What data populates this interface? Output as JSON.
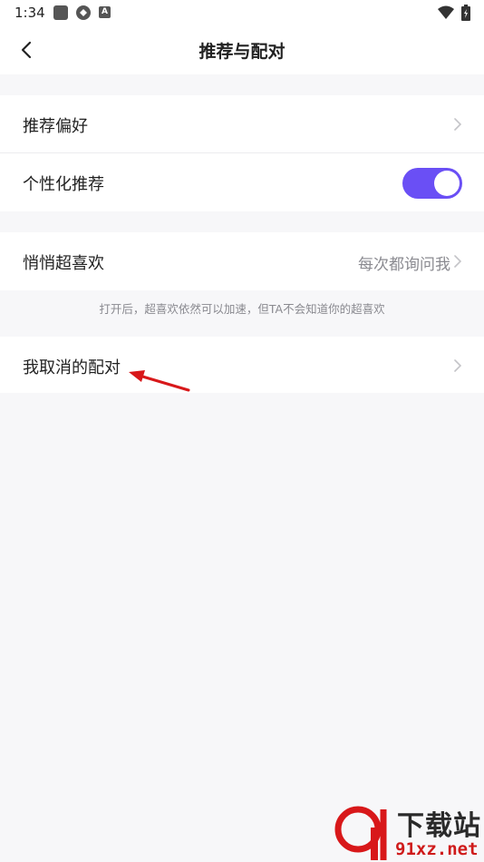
{
  "status_bar": {
    "time": "1:34",
    "icons": [
      "square-icon",
      "sync-icon",
      "a-badge-icon",
      "wifi-icon",
      "battery-charging-icon"
    ],
    "a_badge": "A"
  },
  "nav": {
    "title": "推荐与配对",
    "back_icon": "chevron-left-icon"
  },
  "settings": {
    "recommend_preference": {
      "label": "推荐偏好"
    },
    "personalized": {
      "label": "个性化推荐",
      "toggle_on": true,
      "toggle_color": "#6a4ff5"
    },
    "secret_super_like": {
      "label": "悄悄超喜欢",
      "value": "每次都询问我"
    },
    "hint": "打开后，超喜欢依然可以加速，但TA不会知道你的超喜欢",
    "cancelled_matches": {
      "label": "我取消的配对"
    }
  },
  "annotation": {
    "arrow_color": "#d8181a"
  },
  "watermark": {
    "logo_text": "下载站",
    "domain": "91xz.net"
  }
}
